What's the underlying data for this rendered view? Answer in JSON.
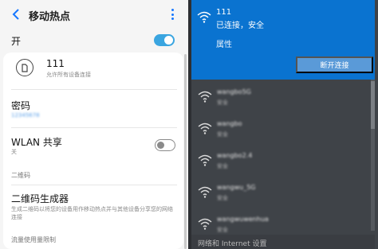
{
  "android": {
    "title": "移动热点",
    "master_toggle_label": "开",
    "master_toggle_on": true,
    "network": {
      "name": "111",
      "subtitle": "允许所有设备连接"
    },
    "password": {
      "label": "密码",
      "value": "12345678"
    },
    "wlan_share": {
      "label": "WLAN 共享",
      "subtitle": "关",
      "on": false
    },
    "qr_section_label": "二维码",
    "qr_generator": {
      "label": "二维码生成器",
      "description": "生成二维码以将您的设备用作移动热点并与其他设备分享您的网络连接"
    },
    "data_limit_section_label": "流量使用量限制"
  },
  "windows": {
    "connected": {
      "name": "111",
      "status": "已连接，安全",
      "properties_label": "属性",
      "disconnect_label": "断开连接"
    },
    "networks": [
      {
        "name": "wangbo5G",
        "security": "安全"
      },
      {
        "name": "wangbo",
        "security": "安全"
      },
      {
        "name": "wangbo2.4",
        "security": "安全"
      },
      {
        "name": "wangwu_5G",
        "security": "安全"
      },
      {
        "name": "wangwuwenhua",
        "security": "安全"
      }
    ],
    "footer_link": "网络和 Internet 设置"
  },
  "colors": {
    "accent_blue": "#0a73d0",
    "toggle_on": "#3aa5e0",
    "flyout_bg": "#3f4348",
    "link_blue": "#1677ff"
  }
}
